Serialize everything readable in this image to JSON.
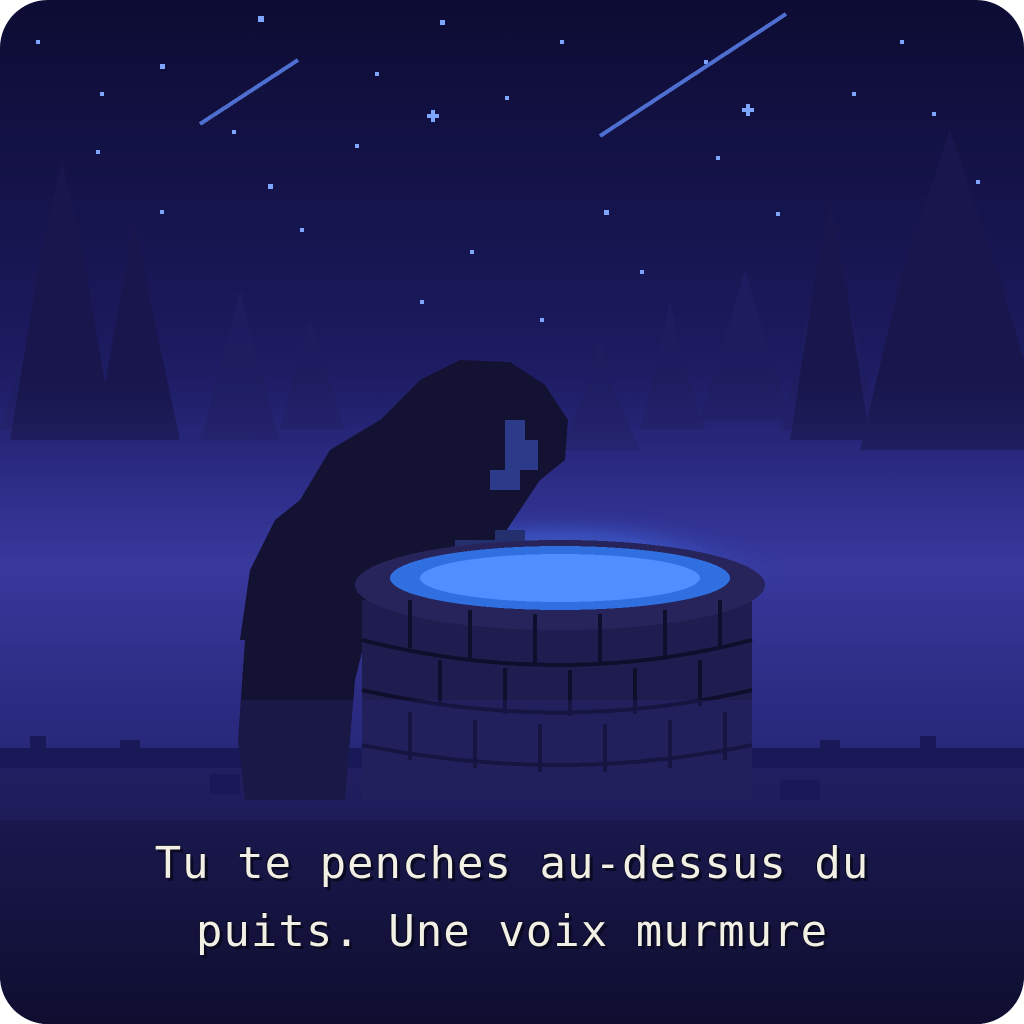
{
  "scene": {
    "name": "night-well-scene",
    "colors": {
      "sky_top": "#0d0c33",
      "sky_mid": "#2a2a86",
      "trees": "#1b1a55",
      "fog": "#3a3aa0",
      "figure": "#141233",
      "well_stone": "#232152",
      "water_glow": "#3f7dff"
    }
  },
  "dialogue": {
    "line1": "Tu te penches au-dessus du",
    "line2": "puits. Une voix murmure"
  }
}
